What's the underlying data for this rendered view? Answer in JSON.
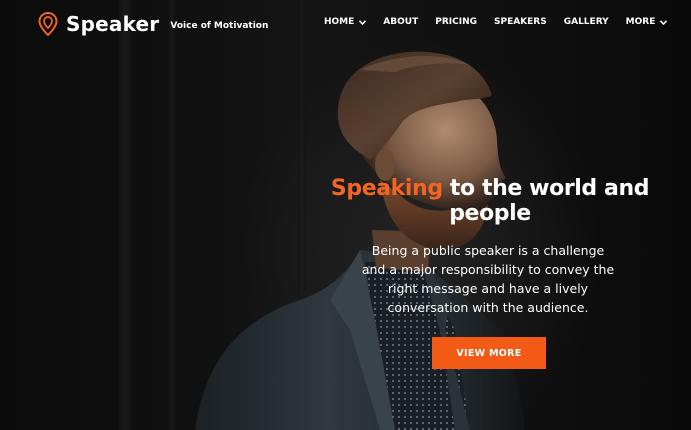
{
  "brand": {
    "name": "Speaker",
    "tagline": "Voice of Motivation",
    "accent_color": "#f26522",
    "logo_icon": "map-pin-icon"
  },
  "nav": {
    "items": [
      {
        "label": "HOME",
        "has_dropdown": true
      },
      {
        "label": "ABOUT",
        "has_dropdown": false
      },
      {
        "label": "PRICING",
        "has_dropdown": false
      },
      {
        "label": "SPEAKERS",
        "has_dropdown": false
      },
      {
        "label": "GALLERY",
        "has_dropdown": false
      },
      {
        "label": "MORE",
        "has_dropdown": true
      }
    ]
  },
  "hero": {
    "headline_accent": "Speaking",
    "headline_rest": " to the world and people",
    "description": "Being a public speaker is a challenge and a major responsibility to convey the right message and have a lively conversation with the audience.",
    "cta_label": "VIEW MORE",
    "cta_color": "#f35a16"
  }
}
